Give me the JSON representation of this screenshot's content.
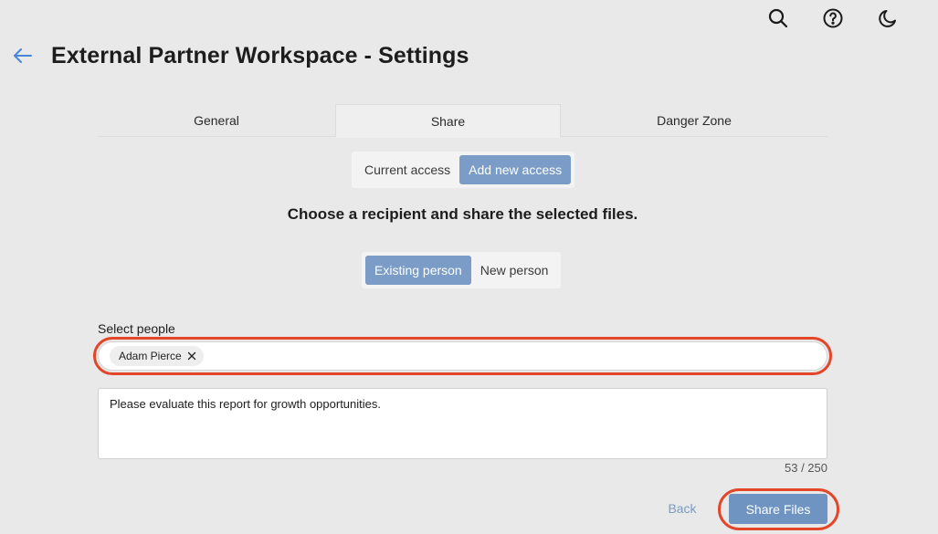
{
  "header": {
    "title": "External Partner Workspace - Settings",
    "icons": [
      "search-icon",
      "help-icon",
      "dark-mode-icon"
    ]
  },
  "tabs": [
    {
      "label": "General",
      "active": false
    },
    {
      "label": "Share",
      "active": true
    },
    {
      "label": "Danger Zone",
      "active": false
    }
  ],
  "access_toggle": {
    "options": [
      "Current access",
      "Add new access"
    ],
    "selected": "Add new access"
  },
  "instructions": "Choose a recipient and share the selected files.",
  "person_toggle": {
    "options": [
      "Existing person",
      "New person"
    ],
    "selected": "Existing person"
  },
  "people": {
    "label": "Select people",
    "selected": [
      "Adam Pierce"
    ]
  },
  "message": {
    "value": "Please evaluate this report for growth opportunities.",
    "counter": "53 / 250"
  },
  "actions": {
    "back_label": "Back",
    "share_label": "Share Files"
  },
  "colors": {
    "accent": "#7a9cc6",
    "primary_button": "#6f94c2",
    "highlight": "#e4462a",
    "background": "#e9e9e9"
  }
}
